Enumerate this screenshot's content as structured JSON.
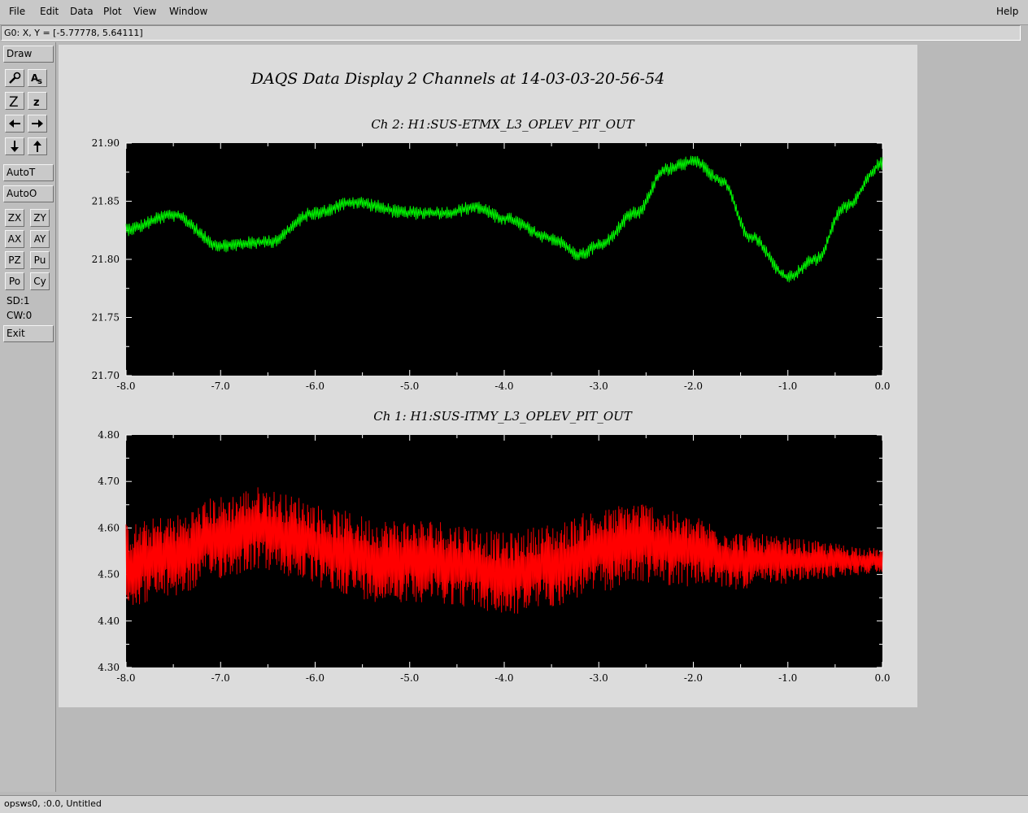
{
  "menubar": {
    "items": [
      {
        "label": "File"
      },
      {
        "label": "Edit"
      },
      {
        "label": "Data"
      },
      {
        "label": "Plot"
      },
      {
        "label": "View"
      },
      {
        "label": "Window"
      }
    ],
    "help": "Help"
  },
  "status": {
    "cursor_readout": "G0: X, Y = [-5.77778, 5.64111]"
  },
  "toolbar": {
    "draw": "Draw",
    "autot": "AutoT",
    "autoo": "AutoO",
    "zx": "ZX",
    "zy": "ZY",
    "ax": "AX",
    "ay": "AY",
    "pz": "PZ",
    "pu": "Pu",
    "po": "Po",
    "cy": "Cy",
    "sd": "SD:1",
    "cw": "CW:0",
    "exit": "Exit",
    "icons": [
      "magnify-icon",
      "text-size-icon",
      "zoom-large-icon",
      "zoom-small-icon",
      "arrow-left-icon",
      "arrow-right-icon",
      "arrow-down-icon",
      "arrow-up-icon"
    ]
  },
  "plot": {
    "main_title": "DAQS Data Display 2 Channels at 14-03-03-20-56-54",
    "background": "#000000",
    "page_bg": "#dcdcdc"
  },
  "bottom": {
    "text": "opsws0, :0.0, Untitled"
  },
  "chart_data": [
    {
      "type": "line",
      "title": "Ch 2:  H1:SUS-ETMX_L3_OPLEV_PIT_OUT",
      "color": "#00ff00",
      "xlim": [
        -8.0,
        0.0
      ],
      "ylim": [
        21.7,
        21.9
      ],
      "xticks": [
        "-8.0",
        "-7.0",
        "-6.0",
        "-5.0",
        "-4.0",
        "-3.0",
        "-2.0",
        "-1.0",
        "0.0"
      ],
      "yticks": [
        "21.90",
        "21.85",
        "21.80",
        "21.75",
        "21.70"
      ],
      "x": [
        -8.0,
        -7.5,
        -7.0,
        -6.5,
        -6.0,
        -5.6,
        -5.0,
        -4.6,
        -4.3,
        -4.0,
        -3.5,
        -3.2,
        -3.0,
        -2.6,
        -2.3,
        -2.0,
        -1.7,
        -1.4,
        -1.0,
        -0.7,
        -0.4,
        0.0
      ],
      "y": [
        21.826,
        21.838,
        21.812,
        21.815,
        21.84,
        21.849,
        21.84,
        21.84,
        21.845,
        21.835,
        21.818,
        21.804,
        21.812,
        21.84,
        21.877,
        21.884,
        21.868,
        21.82,
        21.785,
        21.8,
        21.845,
        21.882
      ],
      "noise": 0.006
    },
    {
      "type": "line",
      "title": "Ch 1:  H1:SUS-ITMY_L3_OPLEV_PIT_OUT",
      "color": "#ff0000",
      "xlim": [
        -8.0,
        0.0
      ],
      "ylim": [
        4.3,
        4.8
      ],
      "xticks": [
        "-8.0",
        "-7.0",
        "-6.0",
        "-5.0",
        "-4.0",
        "-3.0",
        "-2.0",
        "-1.0",
        "0.0"
      ],
      "yticks": [
        "4.80",
        "4.70",
        "4.60",
        "4.50",
        "4.40",
        "4.30"
      ],
      "x": [
        -8.0,
        -7.5,
        -7.0,
        -6.6,
        -6.2,
        -5.8,
        -5.3,
        -4.8,
        -4.4,
        -4.0,
        -3.5,
        -3.0,
        -2.6,
        -2.0,
        -1.5,
        -1.0,
        -0.5,
        0.0
      ],
      "y": [
        4.52,
        4.54,
        4.58,
        4.6,
        4.58,
        4.55,
        4.53,
        4.53,
        4.52,
        4.5,
        4.52,
        4.55,
        4.57,
        4.55,
        4.53,
        4.53,
        4.53,
        4.53
      ],
      "noise_start": 0.09,
      "noise_end": 0.025
    }
  ]
}
